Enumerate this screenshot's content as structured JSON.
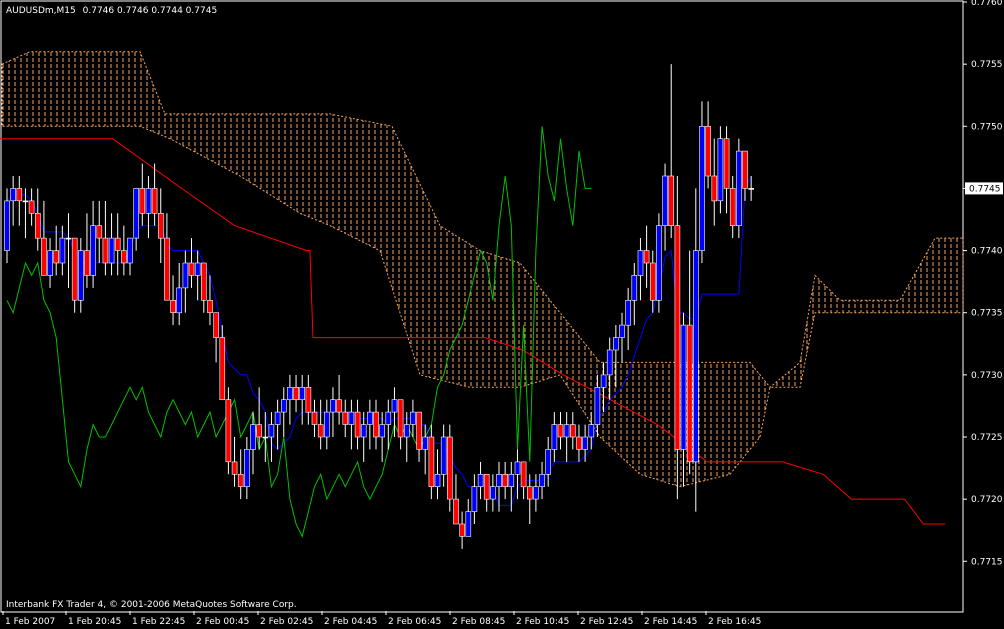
{
  "header": {
    "symbol": "AUDUSDm,M15",
    "ohlc": "0.7746 0.7746 0.7744 0.7745"
  },
  "footer": {
    "copyright": "Interbank FX Trader 4, © 2001-2006 MetaQuotes Software Corp."
  },
  "colors": {
    "background": "#000000",
    "frame": "#ffffff",
    "bull_candle": "#0000ff",
    "bear_candle": "#ff0000",
    "doji": "#ffffff",
    "kijun": "#ff0000",
    "tenkan": "#0000ff",
    "chikou": "#00c000",
    "cloud": "#f4a460",
    "price_box_bg": "#ffffff",
    "price_box_fg": "#000000"
  },
  "chart_data": {
    "type": "candlestick",
    "title": "AUDUSDm,M15",
    "ylim": [
      0.7711,
      0.776
    ],
    "y_ticks": [
      0.776,
      0.7755,
      0.775,
      0.7745,
      0.774,
      0.7735,
      0.773,
      0.7725,
      0.772,
      0.7715
    ],
    "y_tick_labels": [
      "0.7760",
      "0.7755",
      "0.7750",
      "0.7745",
      "0.7740",
      "0.7735",
      "0.7730",
      "0.7725",
      "0.7720",
      "0.7715"
    ],
    "current_price": "0.7745",
    "x_labels": [
      "1 Feb 2007",
      "1 Feb 20:45",
      "1 Feb 22:45",
      "2 Feb 00:45",
      "2 Feb 02:45",
      "2 Feb 04:45",
      "2 Feb 06:45",
      "2 Feb 08:45",
      "2 Feb 10:45",
      "2 Feb 12:45",
      "2 Feb 14:45",
      "2 Feb 16:45"
    ],
    "bar_count": 123,
    "candles": [
      [
        0.774,
        0.7745,
        0.7739,
        0.7744
      ],
      [
        0.7744,
        0.7746,
        0.7742,
        0.7745
      ],
      [
        0.7745,
        0.7746,
        0.7742,
        0.7744
      ],
      [
        0.7744,
        0.7745,
        0.7741,
        0.7744
      ],
      [
        0.7744,
        0.7745,
        0.7742,
        0.7743
      ],
      [
        0.7743,
        0.7745,
        0.774,
        0.7741
      ],
      [
        0.7741,
        0.7744,
        0.7738,
        0.7738
      ],
      [
        0.7738,
        0.7741,
        0.7737,
        0.774
      ],
      [
        0.774,
        0.7742,
        0.7738,
        0.7739
      ],
      [
        0.7739,
        0.7742,
        0.7738,
        0.7741
      ],
      [
        0.7741,
        0.7743,
        0.7737,
        0.7741
      ],
      [
        0.7741,
        0.7741,
        0.7735,
        0.7736
      ],
      [
        0.7736,
        0.7741,
        0.7735,
        0.774
      ],
      [
        0.774,
        0.7743,
        0.7737,
        0.7738
      ],
      [
        0.7738,
        0.7744,
        0.7737,
        0.7742
      ],
      [
        0.7742,
        0.7744,
        0.7739,
        0.7741
      ],
      [
        0.7741,
        0.7744,
        0.7738,
        0.7739
      ],
      [
        0.7739,
        0.7743,
        0.7738,
        0.7741
      ],
      [
        0.7741,
        0.7743,
        0.7738,
        0.774
      ],
      [
        0.774,
        0.7742,
        0.7738,
        0.7739
      ],
      [
        0.7739,
        0.7741,
        0.7738,
        0.7741
      ],
      [
        0.7741,
        0.7745,
        0.774,
        0.7745
      ],
      [
        0.7745,
        0.7747,
        0.7742,
        0.7743
      ],
      [
        0.7743,
        0.7746,
        0.7741,
        0.7745
      ],
      [
        0.7745,
        0.7747,
        0.7742,
        0.7743
      ],
      [
        0.7743,
        0.7745,
        0.7739,
        0.7741
      ],
      [
        0.7741,
        0.7743,
        0.7736,
        0.7736
      ],
      [
        0.7736,
        0.7738,
        0.7734,
        0.7735
      ],
      [
        0.7735,
        0.7739,
        0.7734,
        0.7737
      ],
      [
        0.7737,
        0.774,
        0.7735,
        0.7739
      ],
      [
        0.7739,
        0.7741,
        0.7737,
        0.7738
      ],
      [
        0.7738,
        0.774,
        0.7736,
        0.7739
      ],
      [
        0.7739,
        0.7739,
        0.7735,
        0.7736
      ],
      [
        0.7736,
        0.7738,
        0.7734,
        0.7735
      ],
      [
        0.7735,
        0.7734,
        0.7731,
        0.7733
      ],
      [
        0.7733,
        0.7734,
        0.7728,
        0.7728
      ],
      [
        0.7728,
        0.7729,
        0.7722,
        0.7723
      ],
      [
        0.7723,
        0.7725,
        0.7721,
        0.7722
      ],
      [
        0.7722,
        0.7724,
        0.772,
        0.7721
      ],
      [
        0.7721,
        0.7725,
        0.772,
        0.7724
      ],
      [
        0.7724,
        0.7727,
        0.7722,
        0.7726
      ],
      [
        0.7726,
        0.7729,
        0.7724,
        0.7725
      ],
      [
        0.7725,
        0.7727,
        0.7723,
        0.7725
      ],
      [
        0.7725,
        0.7727,
        0.7723,
        0.7726
      ],
      [
        0.7726,
        0.7728,
        0.7724,
        0.7727
      ],
      [
        0.7727,
        0.7729,
        0.7725,
        0.7728
      ],
      [
        0.7728,
        0.773,
        0.7726,
        0.7729
      ],
      [
        0.7729,
        0.773,
        0.7727,
        0.7728
      ],
      [
        0.7728,
        0.773,
        0.7726,
        0.7729
      ],
      [
        0.7729,
        0.773,
        0.7726,
        0.7727
      ],
      [
        0.7727,
        0.7728,
        0.7725,
        0.7726
      ],
      [
        0.7726,
        0.7728,
        0.7724,
        0.7725
      ],
      [
        0.7725,
        0.7728,
        0.7724,
        0.7727
      ],
      [
        0.7727,
        0.7729,
        0.7725,
        0.7728
      ],
      [
        0.7728,
        0.773,
        0.7726,
        0.7727
      ],
      [
        0.7727,
        0.7728,
        0.7725,
        0.7726
      ],
      [
        0.7726,
        0.7728,
        0.7724,
        0.7727
      ],
      [
        0.7727,
        0.7728,
        0.7724,
        0.7725
      ],
      [
        0.7725,
        0.7727,
        0.7723,
        0.7726
      ],
      [
        0.7726,
        0.7728,
        0.7724,
        0.7727
      ],
      [
        0.7727,
        0.7728,
        0.7724,
        0.7725
      ],
      [
        0.7725,
        0.7727,
        0.7723,
        0.7726
      ],
      [
        0.7726,
        0.7728,
        0.7724,
        0.7727
      ],
      [
        0.7727,
        0.7729,
        0.7725,
        0.7728
      ],
      [
        0.7728,
        0.7728,
        0.7724,
        0.7725
      ],
      [
        0.7725,
        0.7727,
        0.7723,
        0.7726
      ],
      [
        0.7726,
        0.7728,
        0.7725,
        0.7727
      ],
      [
        0.7727,
        0.7727,
        0.7723,
        0.7724
      ],
      [
        0.7724,
        0.7726,
        0.7722,
        0.7725
      ],
      [
        0.7725,
        0.7726,
        0.772,
        0.7721
      ],
      [
        0.7721,
        0.7724,
        0.772,
        0.7722
      ],
      [
        0.7722,
        0.7726,
        0.7721,
        0.7725
      ],
      [
        0.7725,
        0.7726,
        0.7719,
        0.772
      ],
      [
        0.772,
        0.7722,
        0.7718,
        0.7718
      ],
      [
        0.7718,
        0.7719,
        0.7716,
        0.7717
      ],
      [
        0.7717,
        0.772,
        0.7717,
        0.7719
      ],
      [
        0.7719,
        0.7722,
        0.7718,
        0.7721
      ],
      [
        0.7721,
        0.7723,
        0.772,
        0.7722
      ],
      [
        0.7722,
        0.7722,
        0.7719,
        0.772
      ],
      [
        0.772,
        0.7722,
        0.7719,
        0.7721
      ],
      [
        0.7721,
        0.7723,
        0.7719,
        0.7722
      ],
      [
        0.7722,
        0.7723,
        0.772,
        0.7721
      ],
      [
        0.7721,
        0.7723,
        0.7719,
        0.7722
      ],
      [
        0.7722,
        0.7724,
        0.772,
        0.7723
      ],
      [
        0.7723,
        0.7723,
        0.772,
        0.7721
      ],
      [
        0.7721,
        0.7722,
        0.7718,
        0.772
      ],
      [
        0.772,
        0.7722,
        0.7719,
        0.7721
      ],
      [
        0.7721,
        0.7723,
        0.772,
        0.7722
      ],
      [
        0.7722,
        0.7725,
        0.7721,
        0.7724
      ],
      [
        0.7724,
        0.7727,
        0.7723,
        0.7726
      ],
      [
        0.7726,
        0.7727,
        0.7724,
        0.7725
      ],
      [
        0.7725,
        0.7727,
        0.7723,
        0.7726
      ],
      [
        0.7726,
        0.7727,
        0.7724,
        0.7725
      ],
      [
        0.7725,
        0.7726,
        0.7723,
        0.7724
      ],
      [
        0.7724,
        0.7726,
        0.7723,
        0.7725
      ],
      [
        0.7725,
        0.7727,
        0.7724,
        0.7726
      ],
      [
        0.7726,
        0.773,
        0.7725,
        0.7729
      ],
      [
        0.7729,
        0.7731,
        0.7727,
        0.773
      ],
      [
        0.773,
        0.7733,
        0.7728,
        0.7732
      ],
      [
        0.7732,
        0.7734,
        0.7729,
        0.7733
      ],
      [
        0.7733,
        0.7735,
        0.7731,
        0.7734
      ],
      [
        0.7734,
        0.7737,
        0.7732,
        0.7736
      ],
      [
        0.7736,
        0.7739,
        0.7734,
        0.7738
      ],
      [
        0.7738,
        0.7741,
        0.7736,
        0.774
      ],
      [
        0.774,
        0.7742,
        0.7737,
        0.7739
      ],
      [
        0.7739,
        0.774,
        0.7735,
        0.7736
      ],
      [
        0.7736,
        0.7743,
        0.7735,
        0.7742
      ],
      [
        0.7742,
        0.7747,
        0.774,
        0.7746
      ],
      [
        0.7746,
        0.7755,
        0.7741,
        0.7742
      ],
      [
        0.7742,
        0.7746,
        0.772,
        0.7724
      ],
      [
        0.7724,
        0.7735,
        0.7721,
        0.7734
      ],
      [
        0.7734,
        0.774,
        0.7722,
        0.7723
      ],
      [
        0.7723,
        0.7745,
        0.7719,
        0.774
      ],
      [
        0.774,
        0.7752,
        0.7739,
        0.775
      ],
      [
        0.775,
        0.7752,
        0.7745,
        0.7746
      ],
      [
        0.7746,
        0.7749,
        0.7742,
        0.7744
      ],
      [
        0.7744,
        0.775,
        0.7743,
        0.7749
      ],
      [
        0.7749,
        0.775,
        0.7743,
        0.7745
      ],
      [
        0.7745,
        0.7746,
        0.7741,
        0.7742
      ],
      [
        0.7742,
        0.7749,
        0.7741,
        0.7748
      ],
      [
        0.7748,
        0.7748,
        0.7744,
        0.7745
      ],
      [
        0.7745,
        0.7746,
        0.7744,
        0.7745
      ]
    ],
    "kijun": [
      [
        0,
        0.7749
      ],
      [
        36,
        0.7749
      ],
      [
        58,
        0.7745
      ],
      [
        75,
        0.7742
      ],
      [
        98,
        0.774
      ],
      [
        99,
        0.774
      ],
      [
        100,
        0.7733
      ],
      [
        155,
        0.7733
      ],
      [
        167,
        0.7732
      ],
      [
        180,
        0.773
      ],
      [
        195,
        0.7728
      ],
      [
        210,
        0.7726
      ],
      [
        226,
        0.7723
      ],
      [
        250,
        0.7723
      ],
      [
        263,
        0.7722
      ],
      [
        272,
        0.772
      ],
      [
        288,
        0.772
      ],
      [
        289,
        0.772
      ],
      [
        295,
        0.7718
      ],
      [
        302,
        0.7718
      ]
    ],
    "tenkan": [],
    "series_note": ""
  }
}
